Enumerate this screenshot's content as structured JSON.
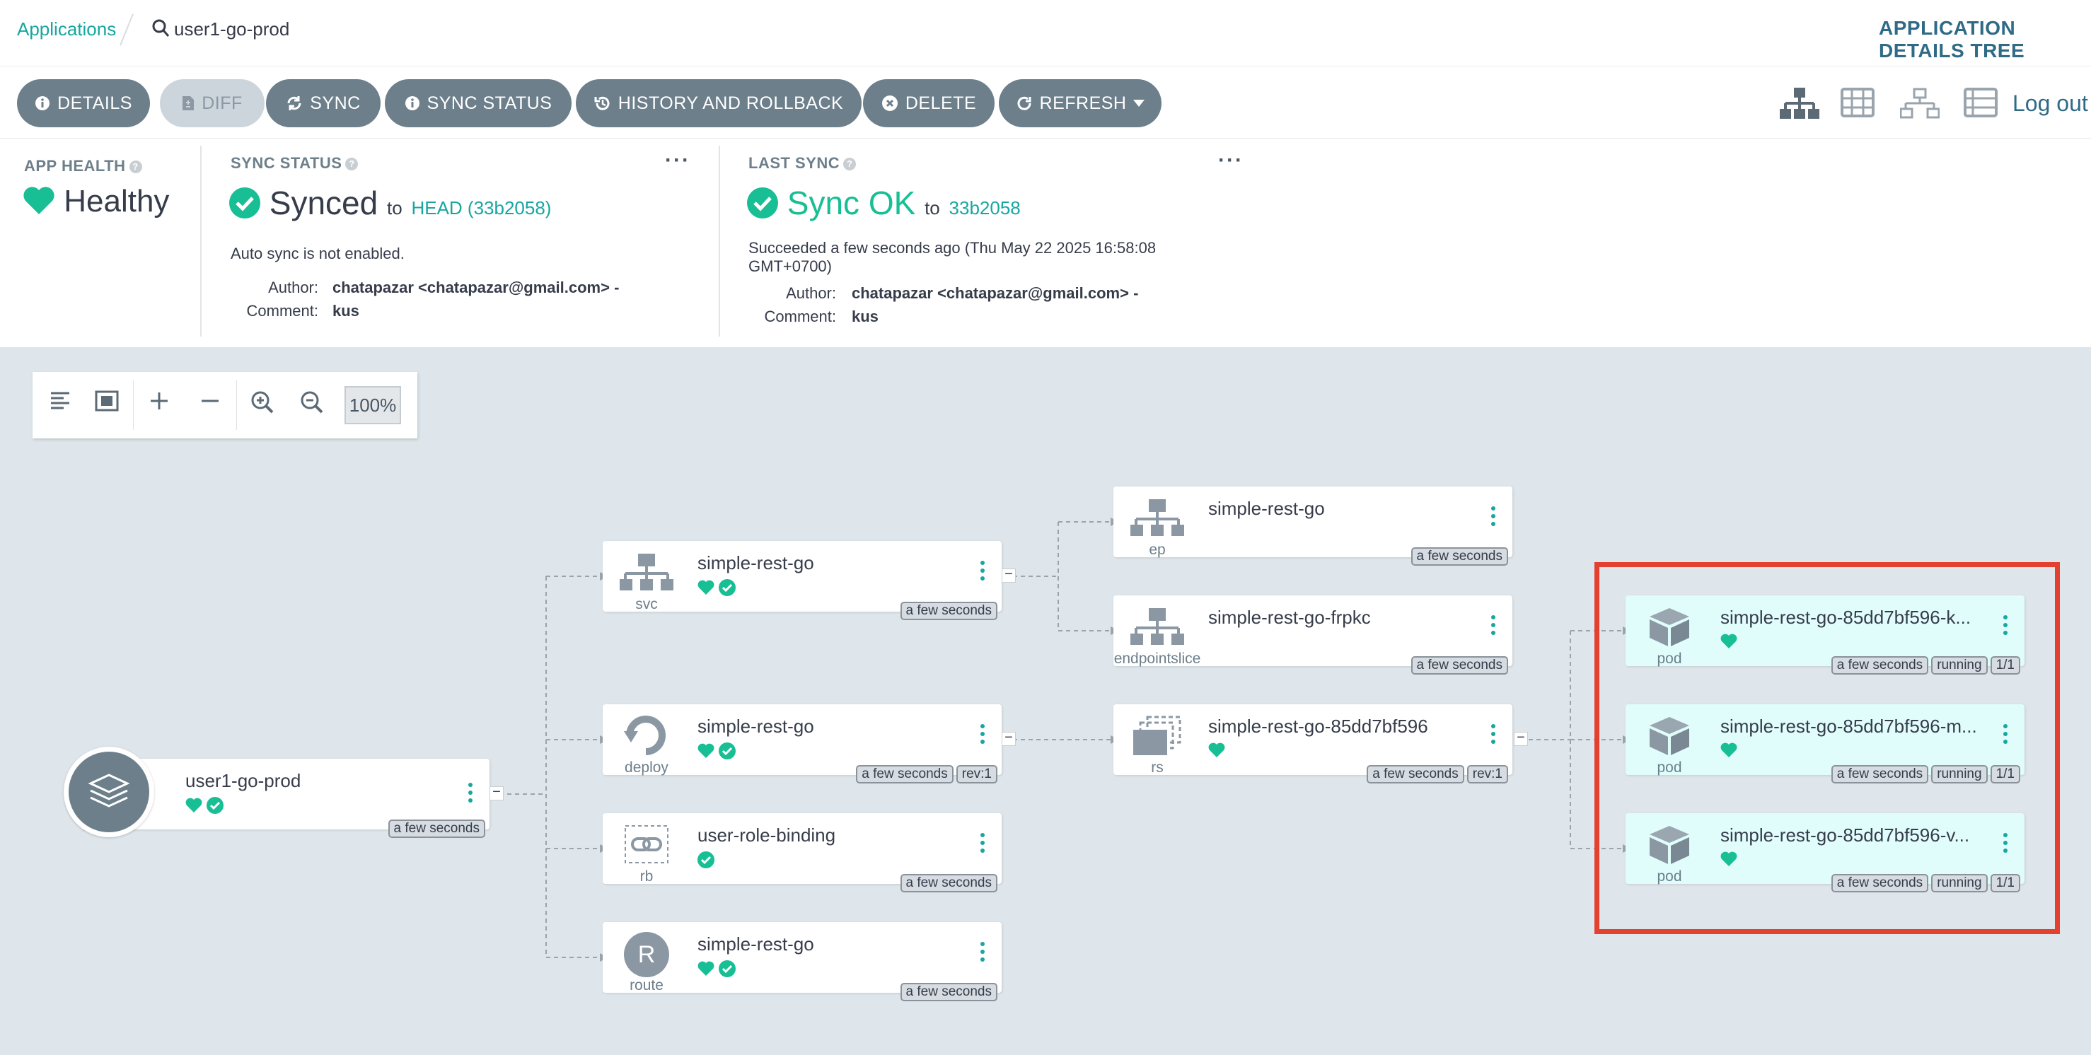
{
  "breadcrumb": {
    "root": "Applications",
    "app": "user1-go-prod"
  },
  "view_title": "APPLICATION DETAILS TREE",
  "toolbar": {
    "details": "DETAILS",
    "diff": "DIFF",
    "sync": "SYNC",
    "sync_status": "SYNC STATUS",
    "history": "HISTORY AND ROLLBACK",
    "delete": "DELETE",
    "refresh": "REFRESH",
    "logout": "Log out"
  },
  "health": {
    "label": "APP HEALTH",
    "value": "Healthy"
  },
  "sync": {
    "label": "SYNC STATUS",
    "value": "Synced",
    "to": "to",
    "rev": "HEAD (33b2058)",
    "auto": "Auto sync is not enabled.",
    "author_k": "Author:",
    "author_v": "chatapazar <chatapazar@gmail.com> -",
    "comment_k": "Comment:",
    "comment_v": "kus"
  },
  "last_sync": {
    "label": "LAST SYNC",
    "value": "Sync OK",
    "to": "to",
    "rev": "33b2058",
    "when1": "Succeeded a few seconds ago (Thu May 22 2025 16:58:08",
    "when2": "GMT+0700)",
    "author_k": "Author:",
    "author_v": "chatapazar <chatapazar@gmail.com> -",
    "comment_k": "Comment:",
    "comment_v": "kus"
  },
  "zoom": "100%",
  "nodes": {
    "app": {
      "name": "user1-go-prod",
      "age": "a few seconds"
    },
    "svc": {
      "name": "simple-rest-go",
      "kind": "svc",
      "age": "a few seconds"
    },
    "deploy": {
      "name": "simple-rest-go",
      "kind": "deploy",
      "age": "a few seconds",
      "rev": "rev:1"
    },
    "rb": {
      "name": "user-role-binding",
      "kind": "rb",
      "age": "a few seconds"
    },
    "route": {
      "name": "simple-rest-go",
      "kind": "route",
      "letter": "R",
      "age": "a few seconds"
    },
    "ep": {
      "name": "simple-rest-go",
      "kind": "ep",
      "age": "a few seconds"
    },
    "eps": {
      "name": "simple-rest-go-frpkc",
      "kind": "endpointslice",
      "age": "a few seconds"
    },
    "rs": {
      "name": "simple-rest-go-85dd7bf596",
      "kind": "rs",
      "age": "a few seconds",
      "rev": "rev:1"
    },
    "pod1": {
      "name": "simple-rest-go-85dd7bf596-k...",
      "kind": "pod",
      "age": "a few seconds",
      "state": "running",
      "ready": "1/1"
    },
    "pod2": {
      "name": "simple-rest-go-85dd7bf596-m...",
      "kind": "pod",
      "age": "a few seconds",
      "state": "running",
      "ready": "1/1"
    },
    "pod3": {
      "name": "simple-rest-go-85dd7bf596-v...",
      "kind": "pod",
      "age": "a few seconds",
      "state": "running",
      "ready": "1/1"
    }
  },
  "colors": {
    "accent": "#17a6a0",
    "healthy": "#18be94",
    "button": "#6d7f8b",
    "highlight": "#e4402f"
  }
}
